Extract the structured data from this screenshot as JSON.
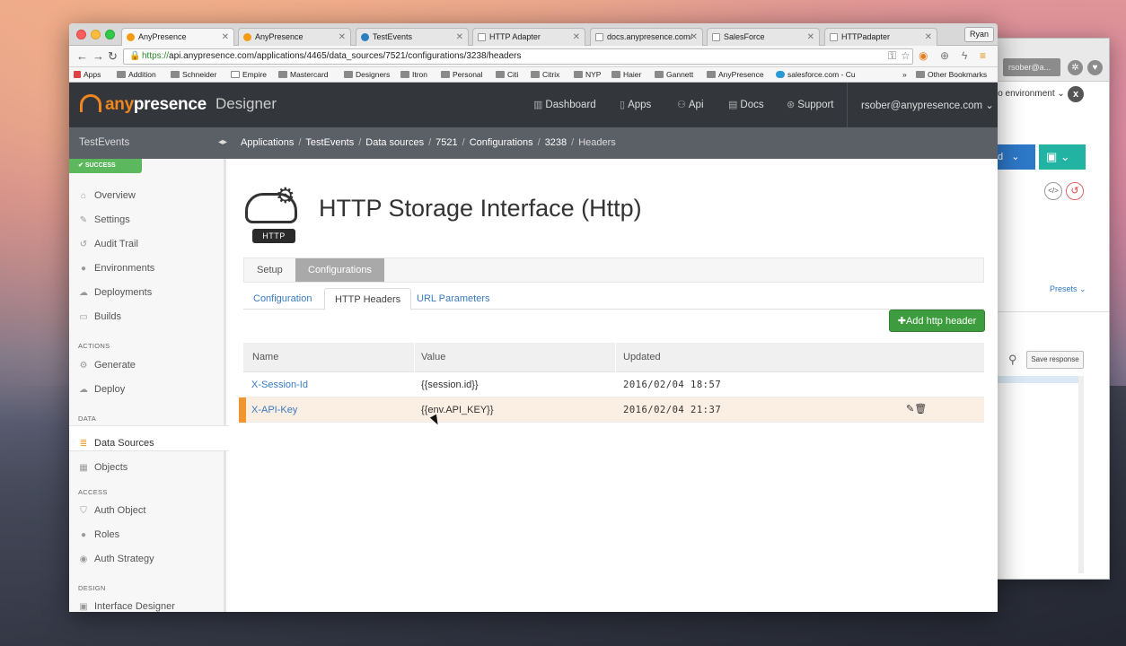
{
  "browser": {
    "tabs": [
      {
        "label": "AnyPresence"
      },
      {
        "label": "AnyPresence"
      },
      {
        "label": "TestEvents"
      },
      {
        "label": "HTTP Adapter"
      },
      {
        "label": "docs.anypresence.com/"
      },
      {
        "label": "SalesForce"
      },
      {
        "label": "HTTPadapter"
      }
    ],
    "profile": "Ryan",
    "url_scheme": "https://",
    "url_rest": "api.anypresence.com/applications/4465/data_sources/7521/configurations/3238/headers",
    "bookmarks": [
      "Apps",
      "Addition",
      "Schneider",
      "Empire",
      "Mastercard",
      "Designers",
      "Itron",
      "Personal",
      "Citi",
      "Citrix",
      "NYP",
      "Haier",
      "Gannett",
      "AnyPresence",
      "salesforce.com - Cu"
    ],
    "other_bookmarks": "Other Bookmarks",
    "more": "»"
  },
  "header": {
    "logo_prefix": "any",
    "logo_suffix": "presence",
    "product": "Designer",
    "nav": [
      {
        "label": "Dashboard",
        "icon": "bar-chart-icon"
      },
      {
        "label": "Apps",
        "icon": "phone-icon"
      },
      {
        "label": "Api",
        "icon": "sitemap-icon"
      },
      {
        "label": "Docs",
        "icon": "book-icon"
      },
      {
        "label": "Support",
        "icon": "lifebuoy-icon"
      }
    ],
    "user": "rsober@anypresence.com"
  },
  "subbar": {
    "app_name": "TestEvents",
    "breadcrumbs": [
      "Applications",
      "TestEvents",
      "Data sources",
      "7521",
      "Configurations",
      "3238",
      "Headers"
    ]
  },
  "sidebar": {
    "status": "SUCCESS",
    "items": [
      "Overview",
      "Settings",
      "Audit Trail",
      "Environments",
      "Deployments",
      "Builds"
    ],
    "actions_heading": "ACTIONS",
    "actions": [
      "Generate",
      "Deploy"
    ],
    "data_heading": "DATA",
    "data": [
      "Data Sources",
      "Objects"
    ],
    "access_heading": "ACCESS",
    "access": [
      "Auth Object",
      "Roles",
      "Auth Strategy"
    ],
    "design_heading": "DESIGN",
    "design": [
      "Interface Designer"
    ]
  },
  "main": {
    "icon_label": "HTTP",
    "title": "HTTP Storage Interface (Http)",
    "tabs": [
      "Setup",
      "Configurations"
    ],
    "active_tab": "Configurations",
    "subtabs": [
      "Configuration",
      "HTTP Headers",
      "URL Parameters"
    ],
    "active_subtab": "HTTP Headers",
    "add_button": "Add http header",
    "table": {
      "columns": [
        "Name",
        "Value",
        "Updated"
      ],
      "rows": [
        {
          "name": "X-Session-Id",
          "value": "{{session.id}}",
          "updated": "2016/02/04 18:57"
        },
        {
          "name": "X-API-Key",
          "value": "{{env.API_KEY}}",
          "updated": "2016/02/04 21:37"
        }
      ]
    }
  },
  "background_app": {
    "user": "rsober@a...",
    "environment": "lo environment",
    "button": "d",
    "presets": "Presets",
    "save_response": "Save response"
  },
  "colors": {
    "header_bg": "#33363b",
    "subbar_bg": "#5b5f66",
    "brand_orange": "#f0861f",
    "success_green": "#5cb85c",
    "add_button_green": "#3d9c3d",
    "link_blue": "#3a7bbf",
    "row_highlight": "#fbeee3",
    "row_marker": "#f0952f"
  }
}
